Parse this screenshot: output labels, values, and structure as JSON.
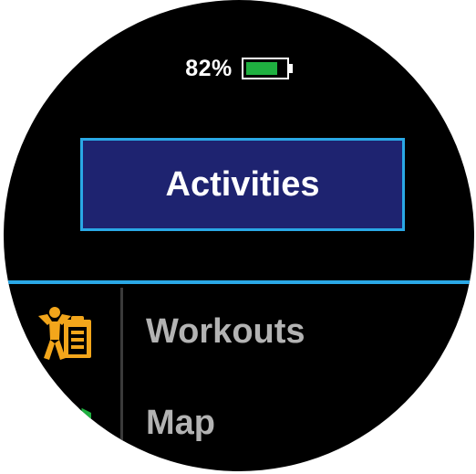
{
  "status": {
    "battery_percent_label": "82%",
    "battery_level": 0.82,
    "battery_fill_color": "#1fb040",
    "battery_icon": "battery-icon"
  },
  "header": {
    "title": "Activities"
  },
  "menu": {
    "items": [
      {
        "label": "Workouts",
        "icon": "workouts-icon",
        "icon_color": "#f3a61b"
      },
      {
        "label": "Map",
        "icon": "map-icon",
        "icon_color": "#1fb040"
      }
    ]
  },
  "colors": {
    "accent": "#2aa8e6",
    "title_bg": "#1e2370",
    "background": "#000000",
    "menu_text": "#b3b3b3"
  }
}
